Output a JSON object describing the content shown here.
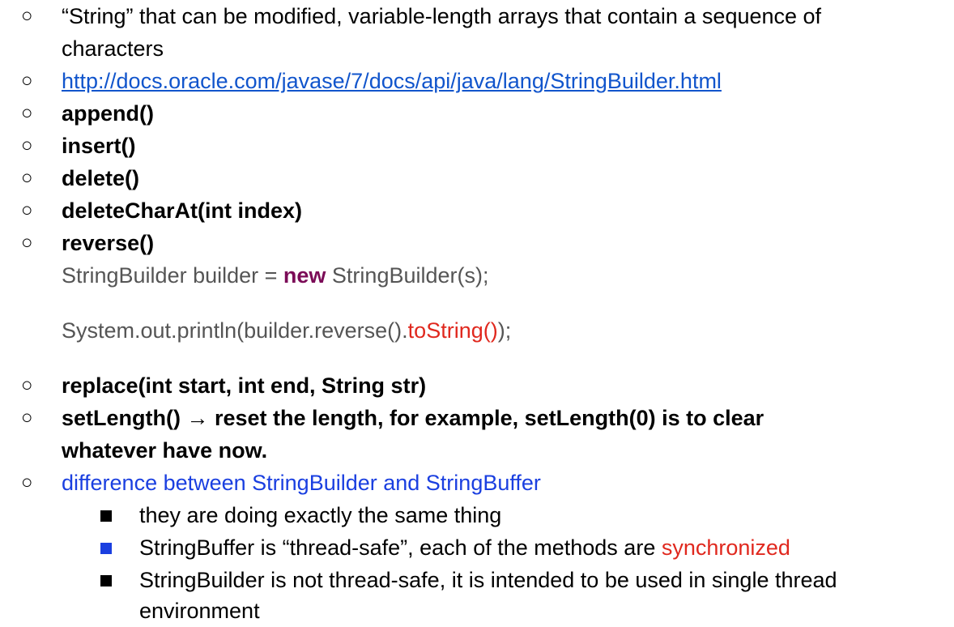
{
  "items": {
    "string_intro_1": "“String” that can be modified, variable-length arrays that contain a sequence of",
    "string_intro_2": "characters",
    "doc_link": "http://docs.oracle.com/javase/7/docs/api/java/lang/StringBuilder.html",
    "append": "append()",
    "insert": "insert()",
    "delete": "delete()",
    "deleteCharAt": "deleteCharAt(int index)",
    "reverse": "reverse()",
    "replace": "replace(int start, int end, String str)",
    "setLength_1": "setLength() → reset the length, for example, setLength(0) is to clear",
    "setLength_2": "whatever have now.",
    "difference": "difference between StringBuilder and StringBuffer"
  },
  "code": {
    "line1_pre": "StringBuilder builder = ",
    "line1_kw": "new",
    "line1_post": " StringBuilder(s);",
    "line2_pre": "System.out.println(builder.reverse().",
    "line2_red": "toString()",
    "line2_post": ");"
  },
  "sub_items": {
    "same": "they are doing exactly the same thing",
    "buffer_pre": "StringBuffer is “thread-safe”, each of the methods are ",
    "buffer_red": "synchronized",
    "builder_1": "StringBuilder is not thread-safe, it is intended to be used in single thread",
    "builder_2": "environment"
  },
  "bullet_char": "○",
  "colors": {
    "link": "#1155cc",
    "keyword": "#7b0b57",
    "red": "#e0281e",
    "blue": "#1a3fe0"
  }
}
